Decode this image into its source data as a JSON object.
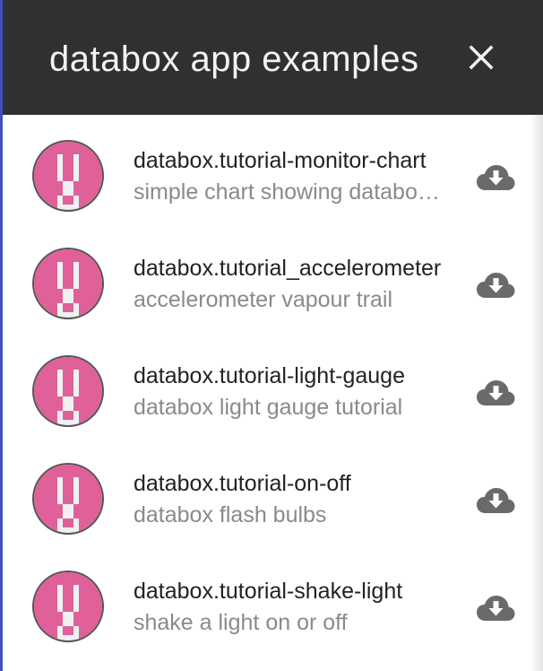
{
  "dialog": {
    "title": "databox app examples",
    "close_icon": "close-icon",
    "header_color": "#303030",
    "accent_color": "#3f4fbf"
  },
  "apps": [
    {
      "name": "databox.tutorial-monitor-chart",
      "description": "simple chart showing databox monitor data",
      "icon": "app-identicon",
      "action_icon": "cloud-download-icon"
    },
    {
      "name": "databox.tutorial_accelerometer",
      "description": "accelerometer vapour trail",
      "icon": "app-identicon",
      "action_icon": "cloud-download-icon"
    },
    {
      "name": "databox.tutorial-light-gauge",
      "description": "databox light gauge tutorial",
      "icon": "app-identicon",
      "action_icon": "cloud-download-icon"
    },
    {
      "name": "databox.tutorial-on-off",
      "description": "databox flash bulbs",
      "icon": "app-identicon",
      "action_icon": "cloud-download-icon"
    },
    {
      "name": "databox.tutorial-shake-light",
      "description": "shake a light on or off",
      "icon": "app-identicon",
      "action_icon": "cloud-download-icon"
    }
  ],
  "colors": {
    "identicon_pink": "#e0609a",
    "identicon_bg": "#f0f0f0",
    "primary_text": "#222222",
    "secondary_text": "#8a8a8a",
    "download_icon": "#6a6a6a"
  }
}
